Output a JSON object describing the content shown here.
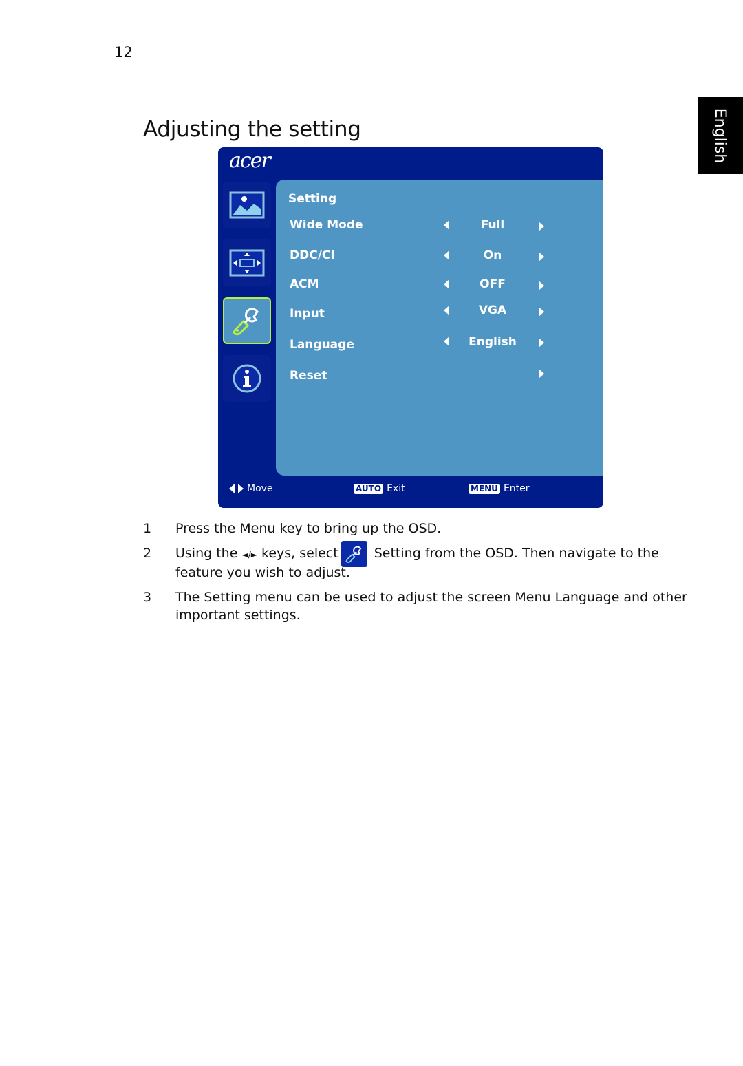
{
  "page": {
    "number": "12",
    "title": "Adjusting the setting",
    "language_tab": "English"
  },
  "osd": {
    "brand": "acer",
    "sidebar": [
      {
        "icon": "picture-icon",
        "active": false
      },
      {
        "icon": "position-icon",
        "active": false
      },
      {
        "icon": "wrench-icon",
        "active": true
      },
      {
        "icon": "info-icon",
        "active": false
      }
    ],
    "heading": "Setting",
    "rows": [
      {
        "label": "Wide Mode",
        "value": "Full",
        "has_left": true,
        "has_right": true
      },
      {
        "label": "DDC/CI",
        "value": "On",
        "has_left": true,
        "has_right": true
      },
      {
        "label": "ACM",
        "value": "OFF",
        "has_left": true,
        "has_right": true
      },
      {
        "label": "Input",
        "value": "VGA",
        "has_left": true,
        "has_right": true
      },
      {
        "label": "Language",
        "value": "English",
        "has_left": true,
        "has_right": true
      },
      {
        "label": "Reset",
        "value": "",
        "has_left": false,
        "has_right": true
      }
    ],
    "footer": {
      "move_label": "Move",
      "auto_key": "AUTO",
      "exit_label": "Exit",
      "menu_key": "MENU",
      "enter_label": "Enter"
    },
    "colors": {
      "frame": "#001b8a",
      "panel": "#4f96c4",
      "active_outline": "#b4f03c"
    }
  },
  "steps": [
    {
      "num": "1",
      "text": "Press the Menu key to bring up the OSD."
    },
    {
      "num": "2",
      "text_before": "Using the",
      "arrows": "◄/►",
      "text_mid": "keys, select",
      "text_after": "Setting from the OSD. Then navigate to the feature you wish to adjust."
    },
    {
      "num": "3",
      "text": "The Setting menu can be used to adjust the screen Menu Language and other important settings."
    }
  ]
}
